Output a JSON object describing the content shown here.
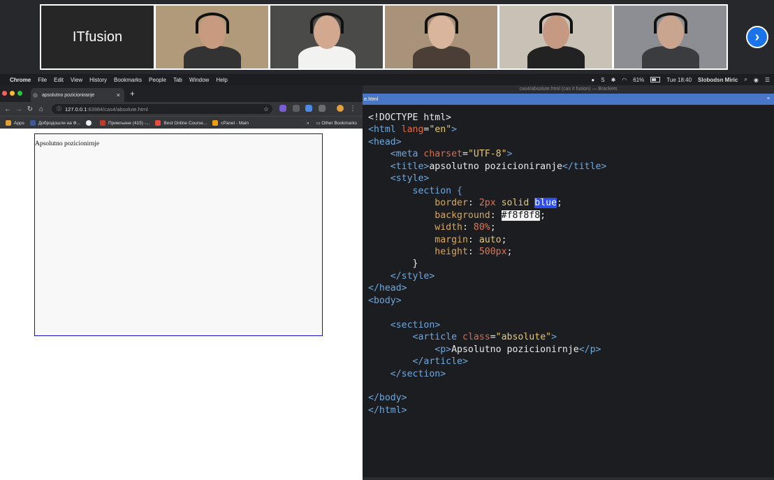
{
  "call": {
    "brand_tile": "ITfusion",
    "participants": [
      {
        "bg": "#b09a7a",
        "skin": "#c89a80",
        "shirt": "#333333"
      },
      {
        "bg": "#4a4a48",
        "skin": "#d2a88e",
        "shirt": "#f2f2f0"
      },
      {
        "bg": "#a8927a",
        "skin": "#d8b59c",
        "shirt": "#4a3e36"
      },
      {
        "bg": "#c8c2b6",
        "skin": "#c69a82",
        "shirt": "#222222"
      },
      {
        "bg": "#8c8e94",
        "skin": "#c9a590",
        "shirt": "#3a3c40"
      }
    ],
    "next_icon": "›"
  },
  "menubar": {
    "apple_icon": "",
    "items": [
      "Chrome",
      "File",
      "Edit",
      "View",
      "History",
      "Bookmarks",
      "People",
      "Tab",
      "Window",
      "Help"
    ],
    "battery": "61%",
    "clock": "Tue 18:40",
    "user": "Slobodsn Miric"
  },
  "chrome": {
    "tab_title": "apsolutno pozicioniranje",
    "tab_close": "×",
    "new_tab": "+",
    "url_host": "127.0.0.1",
    "url_path": ":63984/cas4/absolute.html",
    "bookmarks": [
      {
        "label": "Apps",
        "color": "#e0a030"
      },
      {
        "label": "Добродошли на Ф...",
        "color": "#3b5998"
      },
      {
        "label": "",
        "color": "#eeeeee"
      },
      {
        "label": "Примљене (415) -...",
        "color": "#c0392b"
      },
      {
        "label": "Best Online Course...",
        "color": "#e74c3c"
      },
      {
        "label": "cPanel - Main",
        "color": "#f39c12"
      }
    ],
    "more_bookmarks": "»",
    "other_bookmarks": "Other Bookmarks",
    "page_text": "Apsolutno pozicionirnje"
  },
  "brackets": {
    "window_title": "cas4/absolute.html (cas it fusion) — Brackets",
    "file_tab": "e.html",
    "code": {
      "doctype": "<!DOCTYPE html>",
      "html_open": "<html",
      "lang_attr": "lang",
      "lang_val": "\"en\"",
      "head_open": "<head>",
      "meta_open": "<meta",
      "charset_attr": "charset",
      "charset_val": "\"UTF-8\"",
      "title_open": "<title>",
      "title_text": "apsolutno pozicioniranje",
      "title_close": "</title>",
      "style_open": "<style>",
      "selector": "section {",
      "border_prop": "border",
      "border_num": "2px",
      "border_kw": "solid",
      "border_color": "blue",
      "bg_prop": "background",
      "bg_val": "#f8f8f8",
      "width_prop": "width",
      "width_val": "80%",
      "margin_prop": "margin",
      "margin_val": "auto",
      "height_prop": "height",
      "height_val": "500px",
      "rule_close": "}",
      "style_close": "</style>",
      "head_close": "</head>",
      "body_open": "<body>",
      "section_open": "<section>",
      "article_open": "<article",
      "class_attr": "class",
      "class_val": "\"absolute\"",
      "p_open": "<p>",
      "p_text": "Apsolutno pozicionirnje",
      "p_close": "</p>",
      "article_close": "</article>",
      "section_close": "</section>",
      "body_close": "</body>",
      "html_close": "</html>"
    }
  }
}
